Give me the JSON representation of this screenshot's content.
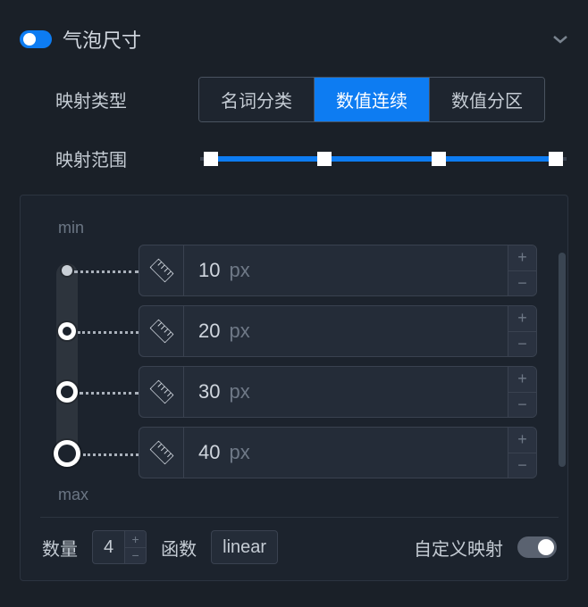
{
  "header": {
    "title": "气泡尺寸"
  },
  "mapping_type": {
    "label": "映射类型",
    "options": [
      "名词分类",
      "数值连续",
      "数值分区"
    ],
    "active_index": 1
  },
  "mapping_range": {
    "label": "映射范围",
    "handle_positions_pct": [
      3,
      34,
      65,
      97
    ]
  },
  "size_panel": {
    "min_label": "min",
    "max_label": "max",
    "unit": "px",
    "rows": [
      {
        "value": "10"
      },
      {
        "value": "20"
      },
      {
        "value": "30"
      },
      {
        "value": "40"
      }
    ]
  },
  "footer": {
    "count_label": "数量",
    "count_value": "4",
    "func_label": "函数",
    "func_value": "linear",
    "custom_label": "自定义映射"
  }
}
